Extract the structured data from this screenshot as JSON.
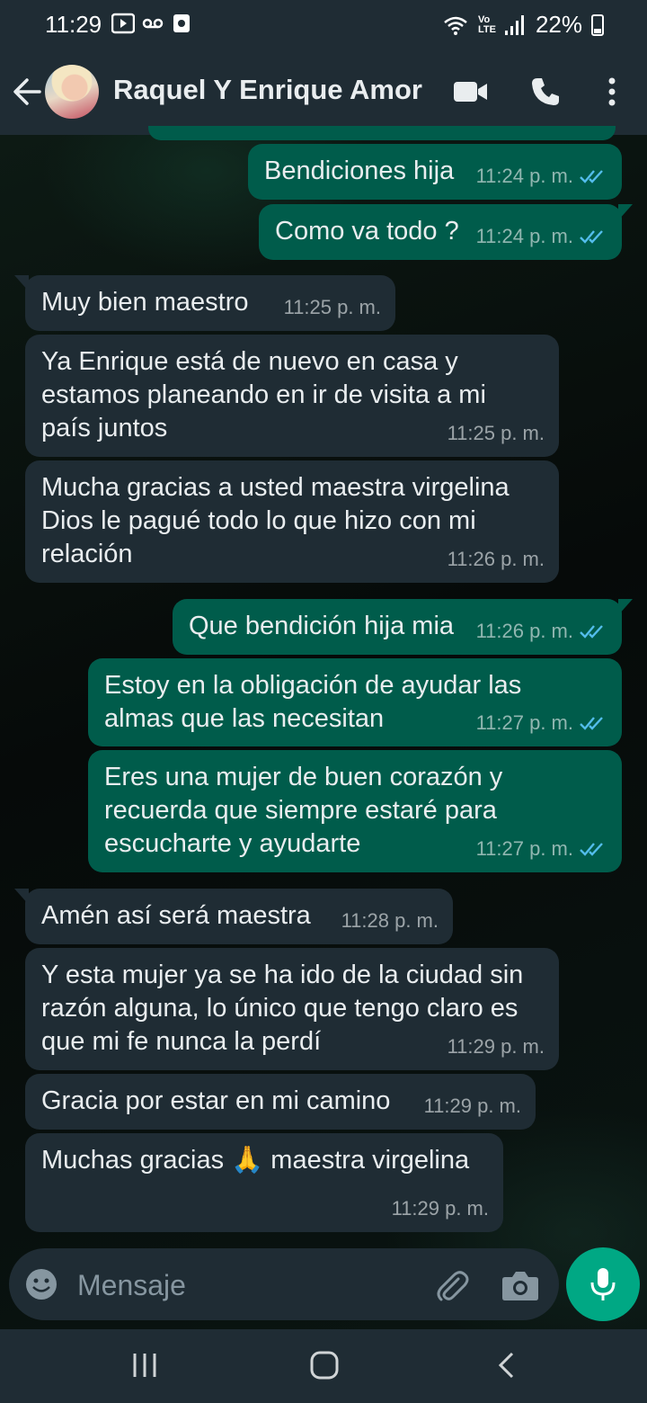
{
  "status_bar": {
    "time": "11:29",
    "network": "Vo LTE",
    "battery": "22%"
  },
  "header": {
    "contact_name": "Raquel Y Enrique Amor"
  },
  "messages": [
    {
      "dir": "out",
      "text": "Bendiciones hija",
      "time": "11:24 p. m.",
      "read": true
    },
    {
      "dir": "out",
      "text": "Como va todo ?",
      "time": "11:24 p. m.",
      "read": true
    },
    {
      "dir": "in",
      "text": "Muy bien maestro",
      "time": "11:25 p. m."
    },
    {
      "dir": "in",
      "text": "Ya Enrique está de nuevo en casa y estamos planeando en ir de visita a mi país juntos",
      "time": "11:25 p. m."
    },
    {
      "dir": "in",
      "text": "Mucha gracias a usted maestra virgelina Dios le pagué todo lo que hizo con mi relación",
      "time": "11:26 p. m."
    },
    {
      "dir": "out",
      "text": "Que bendición hija mia",
      "time": "11:26 p. m.",
      "read": true
    },
    {
      "dir": "out",
      "text": "Estoy en la obligación de ayudar las almas que las necesitan",
      "time": "11:27 p. m.",
      "read": true
    },
    {
      "dir": "out",
      "text": "Eres una mujer de buen corazón y recuerda que siempre estaré para escucharte y ayudarte",
      "time": "11:27 p. m.",
      "read": true
    },
    {
      "dir": "in",
      "text": "Amén así será maestra",
      "time": "11:28 p. m."
    },
    {
      "dir": "in",
      "text": "Y esta mujer ya se ha ido de la ciudad sin razón alguna, lo único que tengo claro es que mi fe nunca la perdí",
      "time": "11:29 p. m."
    },
    {
      "dir": "in",
      "text": "Gracia por estar en mi camino",
      "time": "11:29 p. m."
    },
    {
      "dir": "in",
      "text": "Muchas gracias 🙏 maestra virgelina",
      "time": "11:29 p. m."
    }
  ],
  "composer": {
    "placeholder": "Mensaje"
  },
  "colors": {
    "incoming_bubble": "#1f2c34",
    "outgoing_bubble": "#005c4b",
    "accent": "#00a884",
    "read_ticks": "#53bdeb"
  }
}
